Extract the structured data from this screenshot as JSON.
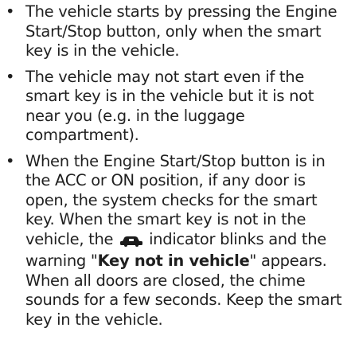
{
  "bullet_symbol": "•",
  "items": [
    {
      "text": "The vehicle starts by pressing the Engine Start/Stop button, only when the smart key is in the vehicle."
    },
    {
      "text": "The vehicle may not start even if the smart key is in the vehicle but it is not near you (e.g. in the luggage compartment)."
    },
    {
      "text_before_icon": "When the Engine Start/Stop button is in the ACC or ON position, if any door is open, the system checks for the smart key. When the smart key is not in the vehicle, the",
      "icon": "key-not-in-vehicle-indicator-icon",
      "text_after_icon": "indicator blinks and the warning \"",
      "warning_bold": "Key not in vehicle",
      "text_end": "\" appears. When all doors are closed, the chime sounds for a few seconds. Keep the smart key in the vehicle."
    }
  ],
  "colors": {
    "text": "#1f1f1f",
    "icon": "#1a1a1a"
  }
}
